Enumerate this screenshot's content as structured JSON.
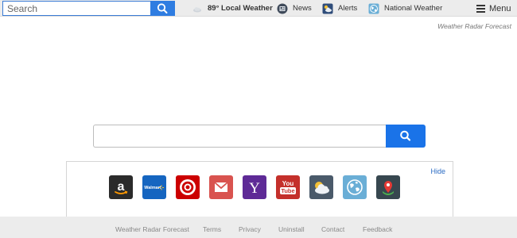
{
  "topbar": {
    "search_placeholder": "Search",
    "weather": "89° Local Weather",
    "news": "News",
    "alerts": "Alerts",
    "national": "National Weather",
    "menu": "Menu"
  },
  "brand_tag": "Weather Radar Forecast",
  "main_search": {
    "placeholder": ""
  },
  "tiles": {
    "hide_label": "Hide",
    "items": [
      {
        "name": "amazon",
        "color": "#2b2b2b"
      },
      {
        "name": "walmart",
        "color": "#1565c0",
        "text": "Walmart"
      },
      {
        "name": "target",
        "color": "#cc0000"
      },
      {
        "name": "gmail",
        "color": "#d9534f"
      },
      {
        "name": "yahoo",
        "color": "#5e2a96",
        "text": "Y"
      },
      {
        "name": "youtube",
        "color": "#c4302b",
        "text1": "You",
        "text2": "Tube"
      },
      {
        "name": "weather",
        "color": "#4a5a6a"
      },
      {
        "name": "globe",
        "color": "#6aaed6"
      },
      {
        "name": "maps",
        "color": "#37474f"
      }
    ]
  },
  "footer": {
    "links": [
      "Weather Radar Forecast",
      "Terms",
      "Privacy",
      "Uninstall",
      "Contact",
      "Feedback"
    ]
  },
  "colors": {
    "accent": "#2f7de1",
    "link": "#2a6bc4",
    "bar_bg": "#ececec"
  }
}
